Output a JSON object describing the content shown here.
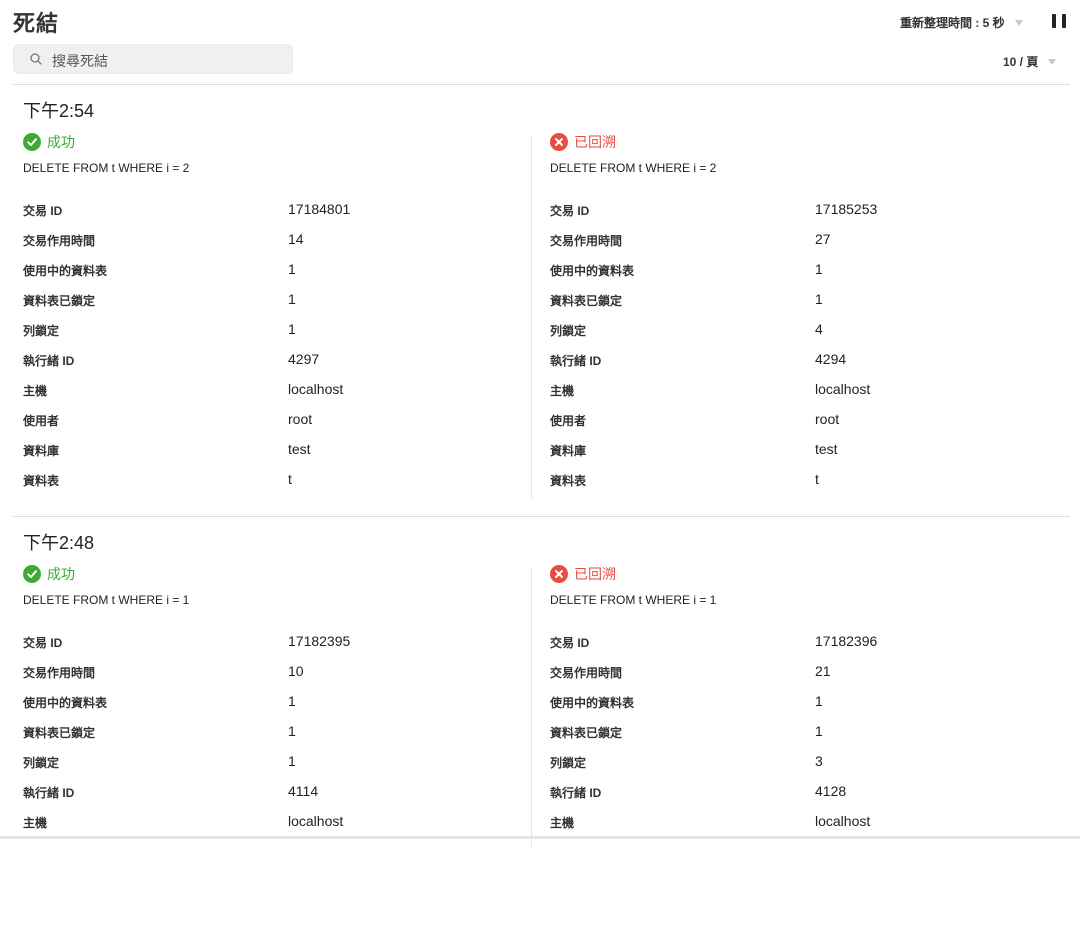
{
  "header": {
    "title": "死結",
    "refresh_label": "重新整理時間 : 5 秒",
    "search_placeholder": "搜尋死結",
    "per_page_label": "10 / 頁"
  },
  "labels": {
    "transaction_id": "交易 ID",
    "duration": "交易作用時間",
    "tables_in_use": "使用中的資料表",
    "tables_locked": "資料表已鎖定",
    "row_locks": "列鎖定",
    "thread_id": "執行緒 ID",
    "host": "主機",
    "user": "使用者",
    "database": "資料庫",
    "table": "資料表"
  },
  "colors": {
    "success": "#3eaa33",
    "rolled_back": "#e84c3d"
  },
  "events": [
    {
      "time": "下午2:54",
      "transactions": [
        {
          "status": "success",
          "status_label": "成功",
          "query": "DELETE FROM t WHERE i = 2",
          "fields": {
            "transaction_id": "17184801",
            "duration": "14",
            "tables_in_use": "1",
            "tables_locked": "1",
            "row_locks": "1",
            "thread_id": "4297",
            "host": "localhost",
            "user": "root",
            "database": "test",
            "table": "t"
          }
        },
        {
          "status": "rolled_back",
          "status_label": "已回溯",
          "query": "DELETE FROM t WHERE i = 2",
          "fields": {
            "transaction_id": "17185253",
            "duration": "27",
            "tables_in_use": "1",
            "tables_locked": "1",
            "row_locks": "4",
            "thread_id": "4294",
            "host": "localhost",
            "user": "root",
            "database": "test",
            "table": "t"
          }
        }
      ]
    },
    {
      "time": "下午2:48",
      "transactions": [
        {
          "status": "success",
          "status_label": "成功",
          "query": "DELETE FROM t WHERE i = 1",
          "fields": {
            "transaction_id": "17182395",
            "duration": "10",
            "tables_in_use": "1",
            "tables_locked": "1",
            "row_locks": "1",
            "thread_id": "4114",
            "host": "localhost"
          }
        },
        {
          "status": "rolled_back",
          "status_label": "已回溯",
          "query": "DELETE FROM t WHERE i = 1",
          "fields": {
            "transaction_id": "17182396",
            "duration": "21",
            "tables_in_use": "1",
            "tables_locked": "1",
            "row_locks": "3",
            "thread_id": "4128",
            "host": "localhost"
          }
        }
      ]
    }
  ]
}
